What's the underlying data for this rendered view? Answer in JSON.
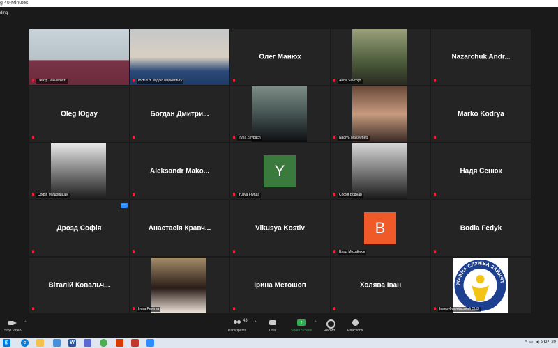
{
  "window": {
    "title": "g 40-Minutes",
    "recording_label": "ding"
  },
  "participants": [
    {
      "name": "Центр Зайнятості",
      "kind": "video",
      "active": true
    },
    {
      "name": "ІВНТУНГ відділ маркетингу",
      "kind": "video"
    },
    {
      "name": "Олег Манюх",
      "kind": "name",
      "display": "Олег Манюх"
    },
    {
      "name": "Anna Savchyn",
      "kind": "video"
    },
    {
      "name": "Nazarchuk Andr...",
      "kind": "name",
      "display": "Nazarchuk Andr..."
    },
    {
      "name": "Oleg IOgay",
      "kind": "name",
      "display": "Oleg IOgay"
    },
    {
      "name": "Богдан Дмитри...",
      "kind": "name",
      "display": "Богдан Дмитри..."
    },
    {
      "name": "Iryna Zhybach",
      "kind": "video"
    },
    {
      "name": "Nadiya Maksymets",
      "kind": "video"
    },
    {
      "name": "Marko Kodrya",
      "kind": "name",
      "display": "Marko Kodrya"
    },
    {
      "name": "Софія Мушопишин",
      "kind": "video"
    },
    {
      "name": "Aleksandr Mako...",
      "kind": "name",
      "display": "Aleksandr Mako..."
    },
    {
      "name": "Yuliya Frytula",
      "kind": "avatar",
      "letter": "Y",
      "color": "#3a7a3c"
    },
    {
      "name": "Софія Боднар",
      "kind": "video"
    },
    {
      "name": "Надя Сенюк",
      "kind": "name",
      "display": "Надя Сенюк"
    },
    {
      "name": "Дрозд Софія",
      "kind": "name",
      "display": "Дрозд Софія"
    },
    {
      "name": "Анастасія Кравч...",
      "kind": "name",
      "display": "Анастасія Кравч..."
    },
    {
      "name": "Vikusya Kostiv",
      "kind": "name",
      "display": "Vikusya Kostiv"
    },
    {
      "name": "Влад Михайлюк",
      "kind": "avatar",
      "letter": "B",
      "color": "#f05a28"
    },
    {
      "name": "Bodia Fedyk",
      "kind": "name",
      "display": "Bodia Fedyk"
    },
    {
      "name": "Віталій Ковальч...",
      "kind": "name",
      "display": "Віталій Ковальч..."
    },
    {
      "name": "Iryna Pererva",
      "kind": "video"
    },
    {
      "name": "Ірина Метошоп",
      "kind": "name",
      "display": "Ірина Метошоп"
    },
    {
      "name": "Холява Іван",
      "kind": "name",
      "display": "Холява Іван"
    },
    {
      "name": "Івано-Франківський ОЦЗ",
      "kind": "logo",
      "logo_text": "ДЕРЖАВНА СЛУЖБА ЗАЙНЯТОСТІ"
    }
  ],
  "toolbar": {
    "stop_video": "Stop Video",
    "participants": "Participants",
    "participants_count": "43",
    "chat": "Chat",
    "share_screen": "Share Screen",
    "record": "Record",
    "reactions": "Reactions"
  },
  "tray": {
    "lang": "УКР",
    "clock": "20"
  },
  "colors": {
    "accent": "#2d8cff",
    "active_speaker": "#a6e22e",
    "share": "#2bb24c"
  }
}
